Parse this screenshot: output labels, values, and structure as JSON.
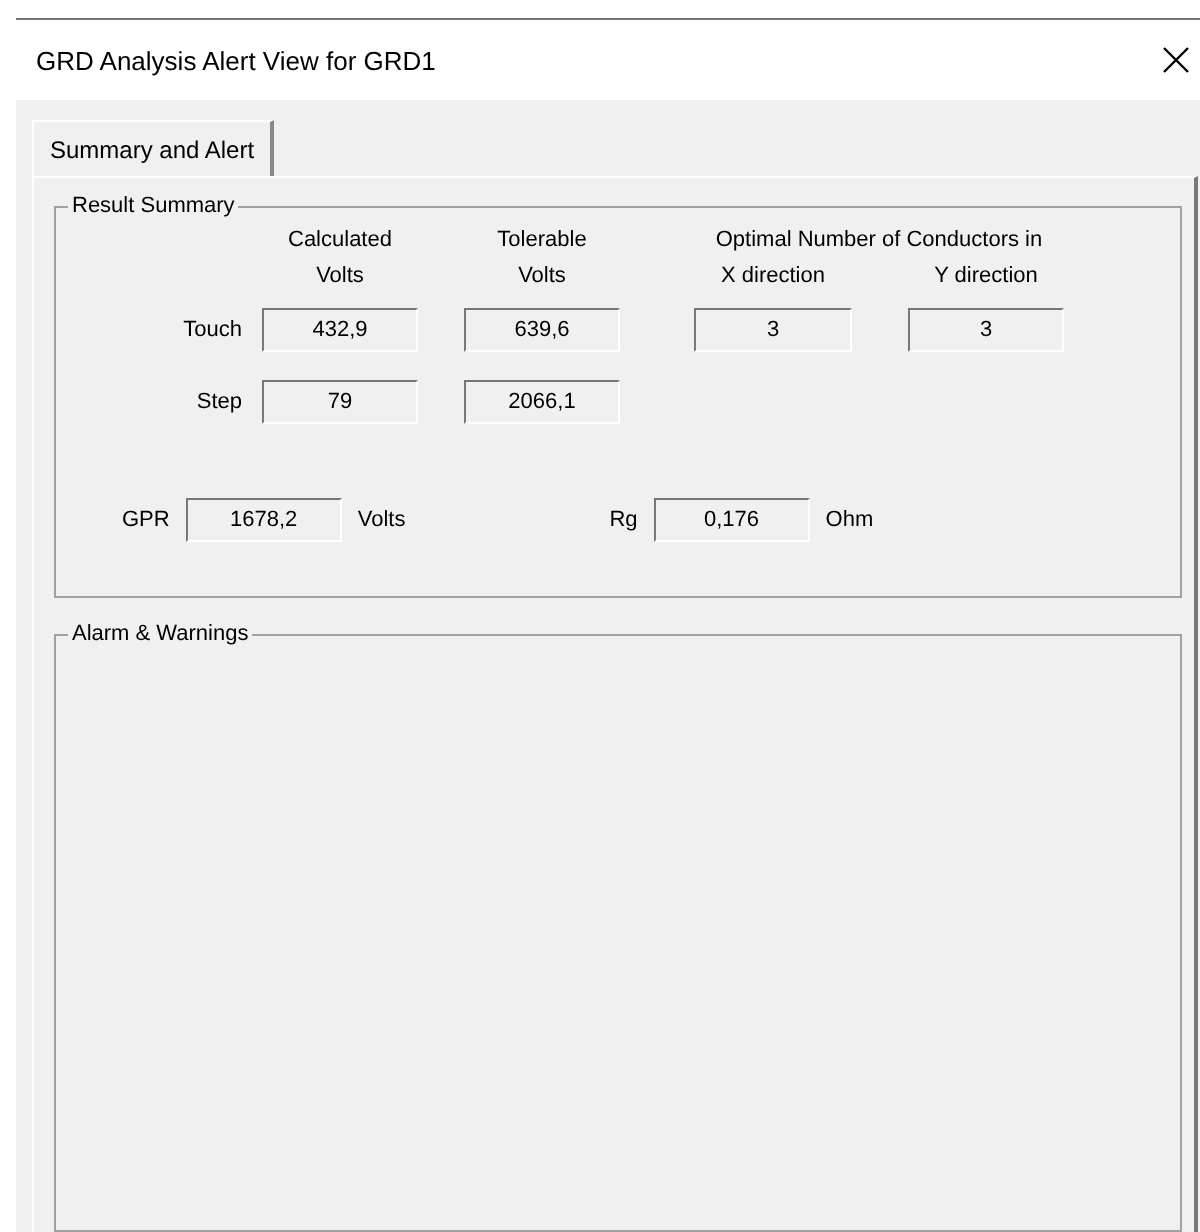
{
  "window": {
    "title": "GRD Analysis Alert View for GRD1"
  },
  "tabs": [
    {
      "label": "Summary and Alert",
      "selected": true
    }
  ],
  "result_summary": {
    "title": "Result Summary",
    "headers": {
      "calculated": "Calculated\nVolts",
      "tolerable": "Tolerable\nVolts",
      "optimal": "Optimal Number of Conductors in",
      "x_direction": "X direction",
      "y_direction": "Y direction"
    },
    "rows": [
      {
        "label": "Touch",
        "calculated": "432,9",
        "tolerable": "639,6",
        "x_direction": "3",
        "y_direction": "3"
      },
      {
        "label": "Step",
        "calculated": "79",
        "tolerable": "2066,1"
      }
    ],
    "gpr": {
      "label": "GPR",
      "value": "1678,2",
      "unit": "Volts"
    },
    "rg": {
      "label": "Rg",
      "value": "0,176",
      "unit": "Ohm"
    }
  },
  "alarms": {
    "title": "Alarm & Warnings"
  }
}
